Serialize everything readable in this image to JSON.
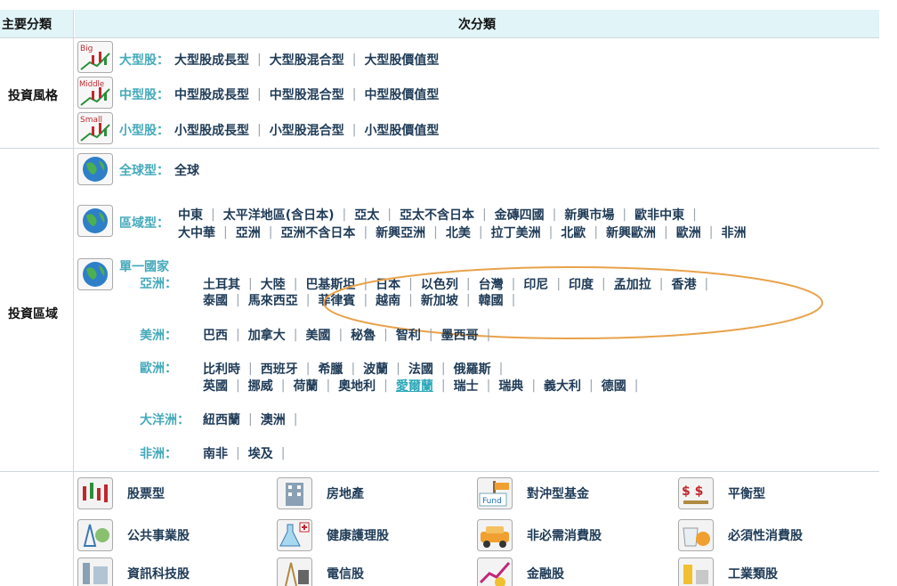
{
  "header": {
    "main_category": "主要分類",
    "sub_category": "次分類"
  },
  "style_section": {
    "label": "投資風格",
    "rows": [
      {
        "badge": "Big",
        "label": "大型股：",
        "items": [
          "大型股成長型",
          "大型股混合型",
          "大型股價值型"
        ]
      },
      {
        "badge": "Middle",
        "label": "中型股：",
        "items": [
          "中型股成長型",
          "中型股混合型",
          "中型股價值型"
        ]
      },
      {
        "badge": "Small",
        "label": "小型股：",
        "items": [
          "小型股成長型",
          "小型股混合型",
          "小型股價值型"
        ]
      }
    ]
  },
  "region_section": {
    "label": "投資區域",
    "global": {
      "label": "全球型：",
      "items": [
        "全球"
      ]
    },
    "area": {
      "label": "區域型：",
      "line1": [
        "中東",
        "太平洋地區(含日本)",
        "亞太",
        "亞太不含日本",
        "金磚四國",
        "新興市場",
        "歐非中東"
      ],
      "line2": [
        "大中華",
        "亞洲",
        "亞洲不含日本",
        "新興亞洲",
        "北美",
        "拉丁美洲",
        "北歐",
        "新興歐洲",
        "歐洲",
        "非洲"
      ]
    },
    "single": {
      "label": "單一國家",
      "asia": {
        "label": "亞洲：",
        "line1": [
          "土耳其",
          "大陸",
          "巴基斯坦",
          "日本",
          "以色列",
          "台灣",
          "印尼",
          "印度",
          "孟加拉",
          "香港"
        ],
        "line2": [
          "泰國",
          "馬來西亞",
          "菲律賓",
          "越南",
          "新加坡",
          "韓國"
        ]
      },
      "america": {
        "label": "美洲：",
        "items": [
          "巴西",
          "加拿大",
          "美國",
          "秘魯",
          "智利",
          "墨西哥"
        ]
      },
      "europe": {
        "label": "歐洲：",
        "line1": [
          "比利時",
          "西班牙",
          "希臘",
          "波蘭",
          "法國",
          "俄羅斯"
        ],
        "line2": [
          "英國",
          "挪威",
          "荷蘭",
          "奧地利",
          "愛爾蘭",
          "瑞士",
          "瑞典",
          "義大利",
          "德國"
        ],
        "selected": "愛爾蘭"
      },
      "oceania": {
        "label": "大洋洲：",
        "items": [
          "紐西蘭",
          "澳洲"
        ]
      },
      "africa": {
        "label": "非洲：",
        "items": [
          "南非",
          "埃及"
        ]
      }
    }
  },
  "industry": {
    "items": [
      {
        "label": "股票型",
        "icon": "candlestick-icon"
      },
      {
        "label": "房地產",
        "icon": "building-icon"
      },
      {
        "label": "對沖型基金",
        "icon": "fund-sign-icon",
        "icon_text": "Fund"
      },
      {
        "label": "平衡型",
        "icon": "dollar-scale-icon",
        "icon_text": "$ $"
      },
      {
        "label": "公共事業股",
        "icon": "utility-icon"
      },
      {
        "label": "健康護理股",
        "icon": "medical-flask-icon"
      },
      {
        "label": "非必需消費股",
        "icon": "car-icon"
      },
      {
        "label": "必須性消費股",
        "icon": "food-icon"
      },
      {
        "label": "資訊科技股",
        "icon": "tech-icon"
      },
      {
        "label": "電信股",
        "icon": "telecom-icon"
      },
      {
        "label": "金融股",
        "icon": "finance-icon"
      },
      {
        "label": "工業類股",
        "icon": "industry-icon"
      }
    ]
  },
  "colors": {
    "header_bg": "#e1f4f8",
    "label": "#45aabb",
    "link": "#1f3b57",
    "highlight_ellipse": "#e8a24a"
  }
}
